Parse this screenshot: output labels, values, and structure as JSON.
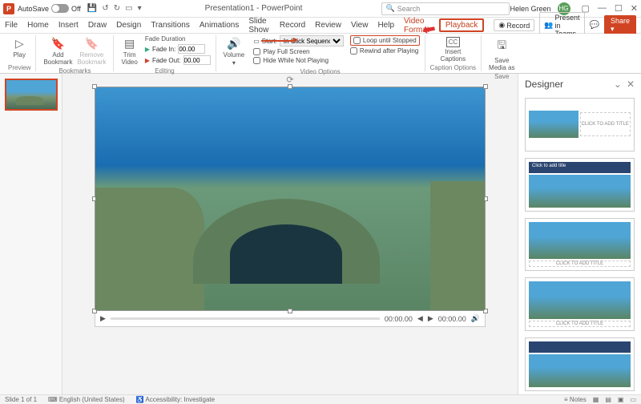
{
  "titlebar": {
    "app_letter": "P",
    "autosave_label": "AutoSave",
    "autosave_state": "Off",
    "doc_title": "Presentation1 - PowerPoint",
    "search_placeholder": "Search",
    "user_name": "Helen Green",
    "user_initials": "HG"
  },
  "menu": {
    "tabs": [
      "File",
      "Home",
      "Insert",
      "Draw",
      "Design",
      "Transitions",
      "Animations",
      "Slide Show",
      "Record",
      "Review",
      "View",
      "Help",
      "Video Format",
      "Playback"
    ],
    "active": "Playback",
    "record_btn": "Record",
    "present_btn": "Present in Teams",
    "share_btn": "Share"
  },
  "ribbon": {
    "preview": {
      "play": "Play",
      "label": "Preview"
    },
    "bookmarks": {
      "add": "Add\nBookmark",
      "remove": "Remove\nBookmark",
      "label": "Bookmarks"
    },
    "editing": {
      "trim": "Trim\nVideo",
      "fade_duration": "Fade Duration",
      "fade_in_label": "Fade In:",
      "fade_in_val": "00.00",
      "fade_out_label": "Fade Out:",
      "fade_out_val": "00.00",
      "label": "Editing"
    },
    "video_options": {
      "volume": "Volume",
      "start_label": "Start:",
      "start_val": "In Click Sequence",
      "play_full": "Play Full Screen",
      "hide_not_playing": "Hide While Not Playing",
      "loop": "Loop until Stopped",
      "rewind": "Rewind after Playing",
      "label": "Video Options"
    },
    "caption_options": {
      "insert_captions": "Insert\nCaptions",
      "label": "Caption Options"
    },
    "save": {
      "save_media": "Save\nMedia as",
      "label": "Save"
    }
  },
  "player": {
    "time_current": "00:00.00",
    "time_total": "00:00.00"
  },
  "designer": {
    "title": "Designer",
    "placeholder_1": "CLICK TO ADD TITLE",
    "placeholder_2": "Click to add title",
    "placeholder_3": "CLICK TO ADD TITLE",
    "placeholder_4": "CLICK TO ADD TITLE"
  },
  "status": {
    "slide": "Slide 1 of 1",
    "lang": "English (United States)",
    "access": "Accessibility: Investigate",
    "notes": "Notes"
  }
}
